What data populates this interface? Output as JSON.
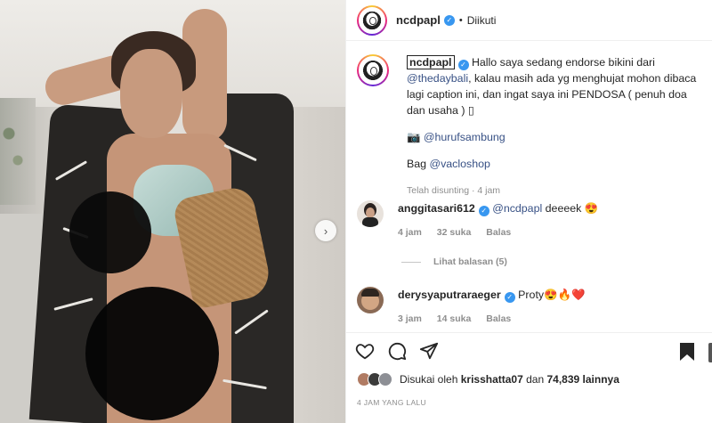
{
  "header": {
    "username": "ncdpapl",
    "separator": "•",
    "follow_status": "Diikuti"
  },
  "caption": {
    "username": "ncdpapl",
    "text_1": "Hallo saya sedang endorse bikini dari ",
    "mention_1": "@thedaybali",
    "text_2": ", kalau masih ada yg menghujat mohon dibaca lagi caption ini, dan ingat saya ini PENDOSA ( penuh doa dan usaha ) ",
    "unknown_glyph": "▯",
    "camera_emoji": "📷",
    "photo_credit": "@hurufsambung",
    "bag_label": "Bag ",
    "bag_mention": "@vacloshop",
    "meta": "Telah disunting · 4 jam"
  },
  "comments": [
    {
      "username": "anggitasari612",
      "mention": "@ncdpapl",
      "text": " deeeek ",
      "emoji": "😍",
      "time": "4 jam",
      "likes": "32 suka",
      "reply_label": "Balas"
    },
    {
      "username": "derysyaputraraeger",
      "text": " Proty",
      "emoji": "😍🔥❤️",
      "time": "3 jam",
      "likes": "14 suka",
      "reply_label": "Balas"
    }
  ],
  "view_replies": "Lihat balasan (5)",
  "likes": {
    "prefix": "Disukai oleh ",
    "user": "krisshatta07",
    "middle": " dan ",
    "count": "74,839 lainnya"
  },
  "timestamp": "4 JAM YANG LALU",
  "icons": {
    "next": "chevron-right-icon",
    "like": "heart-icon",
    "comment": "comment-icon",
    "share": "share-icon",
    "save": "bookmark-icon",
    "verified": "verified-badge-icon"
  },
  "colors": {
    "verified": "#3897f0",
    "link": "#385185",
    "muted": "#8e8e8e",
    "text": "#262626"
  }
}
